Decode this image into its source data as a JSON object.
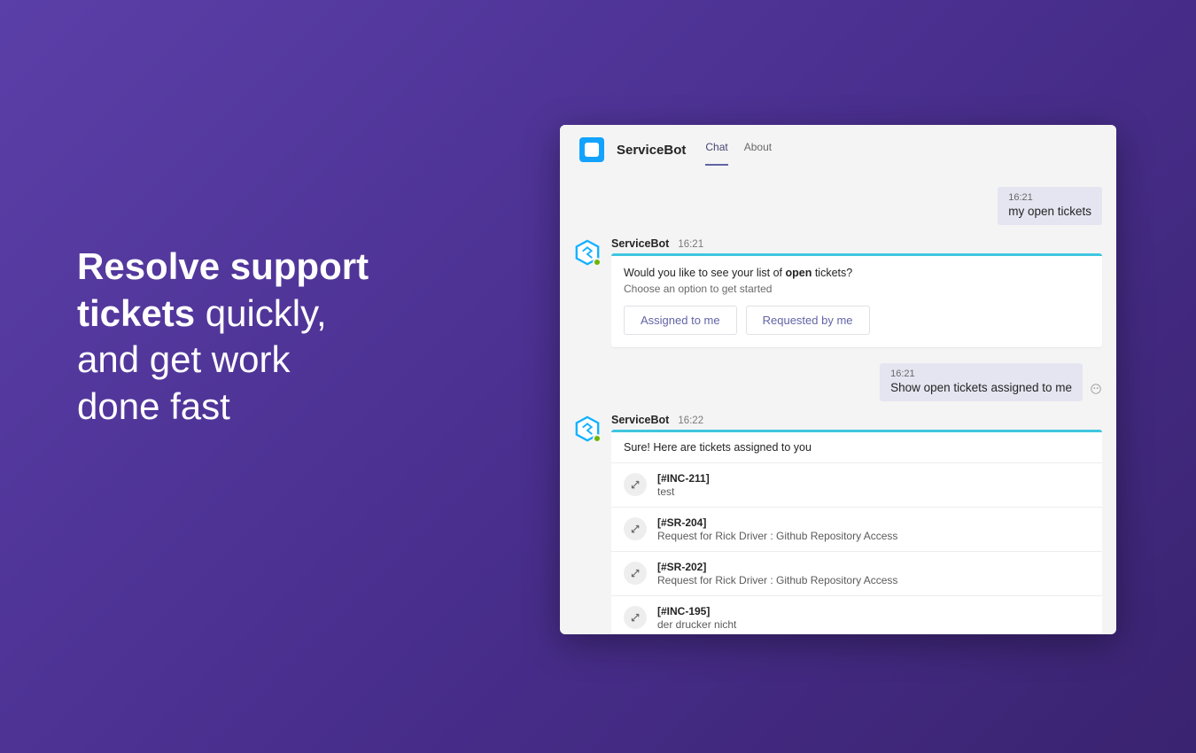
{
  "hero": {
    "bold_1": "Resolve support",
    "bold_2": "tickets",
    "rest_1": " quickly,",
    "rest_2": "and get work",
    "rest_3": "done fast"
  },
  "app": {
    "name": "ServiceBot",
    "tabs": {
      "chat": "Chat",
      "about": "About"
    }
  },
  "messages": {
    "user1": {
      "time": "16:21",
      "text": "my open tickets"
    },
    "bot1": {
      "name": "ServiceBot",
      "time": "16:21",
      "prompt_pre": "Would you like to see your list of ",
      "prompt_bold": "open",
      "prompt_post": " tickets?",
      "sub": "Choose an option to get started",
      "btn_assigned": "Assigned to me",
      "btn_requested": "Requested by me"
    },
    "user2": {
      "time": "16:21",
      "text": "Show open tickets assigned to me"
    },
    "bot2": {
      "name": "ServiceBot",
      "time": "16:22",
      "intro": "Sure! Here are tickets assigned to you",
      "tickets": [
        {
          "id": "[#INC-211]",
          "subject": "test"
        },
        {
          "id": "[#SR-204]",
          "subject": "Request for Rick Driver : Github Repository Access"
        },
        {
          "id": "[#SR-202]",
          "subject": "Request for Rick Driver : Github Repository Access"
        },
        {
          "id": "[#INC-195]",
          "subject": "der drucker nicht"
        }
      ]
    }
  }
}
